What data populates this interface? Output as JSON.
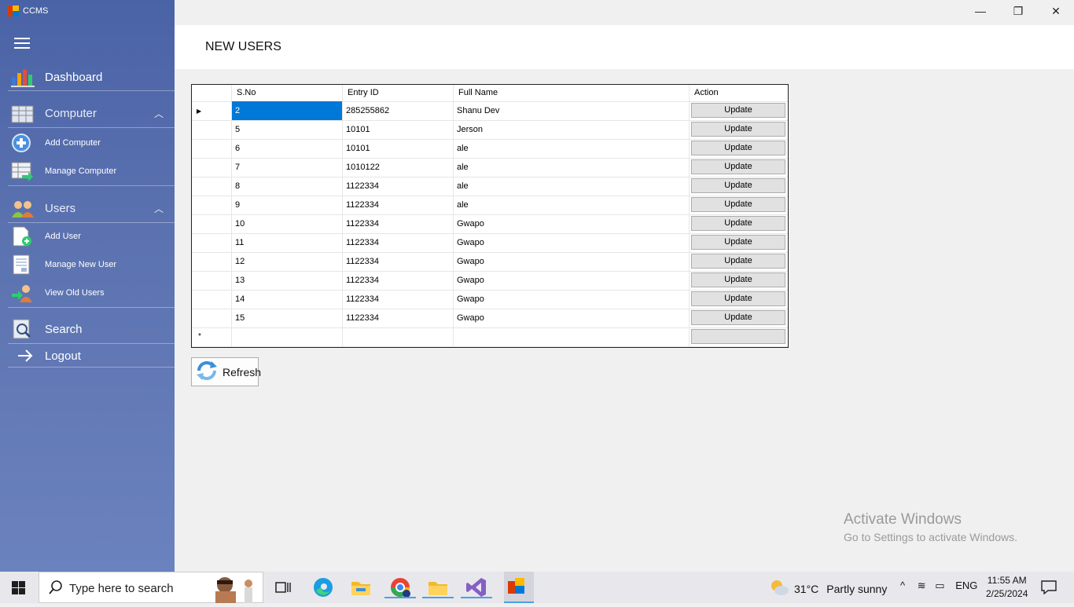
{
  "app": {
    "title": "CCMS"
  },
  "sidebar": {
    "dashboard": "Dashboard",
    "computer_group": "Computer",
    "add_computer": "Add Computer",
    "manage_computer": "Manage Computer",
    "users_group": "Users",
    "add_user": "Add User",
    "manage_new_user": "Manage New User",
    "view_old_users": "View Old Users",
    "search": "Search",
    "logout": "Logout"
  },
  "main": {
    "page_title": "NEW USERS",
    "refresh_label": "Refresh",
    "grid": {
      "headers": [
        "S.No",
        "Entry ID",
        "Full Name",
        "Action"
      ],
      "action_label": "Update",
      "new_row_marker": "*",
      "rows": [
        {
          "sno": "2",
          "entry_id": "285255862",
          "name": "Shanu Dev"
        },
        {
          "sno": "5",
          "entry_id": "10101",
          "name": "Jerson"
        },
        {
          "sno": "6",
          "entry_id": "10101",
          "name": "ale"
        },
        {
          "sno": "7",
          "entry_id": "1010122",
          "name": "ale"
        },
        {
          "sno": "8",
          "entry_id": "1122334",
          "name": "ale"
        },
        {
          "sno": "9",
          "entry_id": "1122334",
          "name": "ale"
        },
        {
          "sno": "10",
          "entry_id": "1122334",
          "name": "Gwapo"
        },
        {
          "sno": "11",
          "entry_id": "1122334",
          "name": "Gwapo"
        },
        {
          "sno": "12",
          "entry_id": "1122334",
          "name": "Gwapo"
        },
        {
          "sno": "13",
          "entry_id": "1122334",
          "name": "Gwapo"
        },
        {
          "sno": "14",
          "entry_id": "1122334",
          "name": "Gwapo"
        },
        {
          "sno": "15",
          "entry_id": "1122334",
          "name": "Gwapo"
        }
      ]
    }
  },
  "watermark": {
    "line1": "Activate Windows",
    "line2": "Go to Settings to activate Windows."
  },
  "taskbar": {
    "search_placeholder": "Type here to search",
    "weather_temp": "31°C",
    "weather_desc": "Partly sunny",
    "language": "ENG",
    "time": "11:55 AM",
    "date": "2/25/2024"
  },
  "colors": {
    "sidebar": "#5b72b0",
    "selection": "#0078d7"
  }
}
